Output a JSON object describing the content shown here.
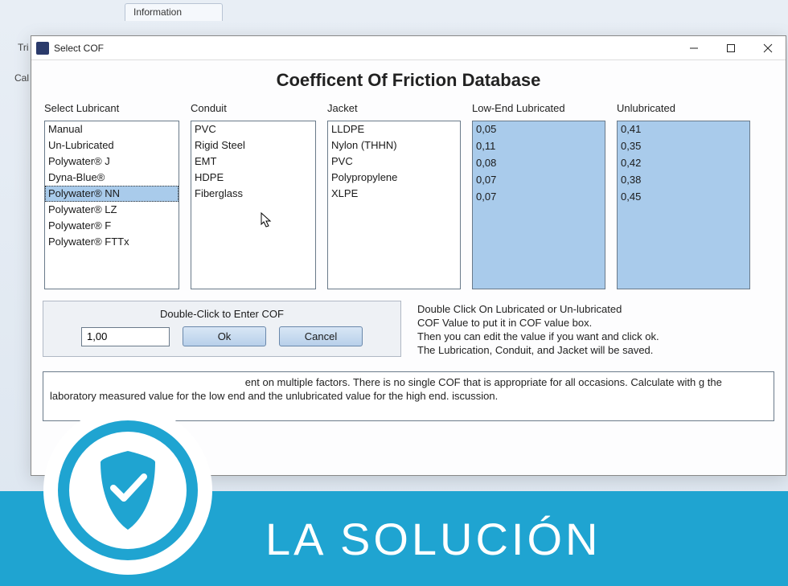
{
  "background": {
    "tab_label": "Information",
    "tri_label": "Tri",
    "cal_label": "Cal"
  },
  "window": {
    "title": "Select COF"
  },
  "main_title": "Coefficent Of Friction Database",
  "headers": {
    "lubricant": "Select Lubricant",
    "conduit": "Conduit",
    "jacket": "Jacket",
    "lowend": "Low-End Lubricated",
    "unlub": "Unlubricated"
  },
  "lubricants": [
    "Manual",
    "Un-Lubricated",
    "Polywater® J",
    "Dyna-Blue®",
    "Polywater® NN",
    "Polywater® LZ",
    "Polywater® F",
    "Polywater® FTTx"
  ],
  "lubricant_selected_index": 4,
  "conduits": [
    "PVC",
    "Rigid Steel",
    "EMT",
    "HDPE",
    "Fiberglass"
  ],
  "jackets": [
    "LLDPE",
    "Nylon (THHN)",
    "PVC",
    "Polypropylene",
    "XLPE"
  ],
  "lowend_values": [
    "0,05",
    "0,11",
    "0,08",
    "0,07",
    "0,07"
  ],
  "unlub_values": [
    "0,41",
    "0,35",
    "0,42",
    "0,38",
    "0,45"
  ],
  "cof_panel": {
    "label": "Double-Click to Enter COF",
    "value": "1,00",
    "ok": "Ok",
    "cancel": "Cancel"
  },
  "instructions": {
    "l1": "Double Click On Lubricated or Un-lubricated",
    "l2": "COF Value to put it in COF value box.",
    "l3": "Then you can edit the value if you want and click ok.",
    "l4": "The Lubrication, Conduit, and Jacket will be saved."
  },
  "info_text": "ent on multiple factors. There is no single COF that is appropriate for all occasions.  Calculate with g the laboratory measured value for the low end and the unlubricated value for the high end. iscussion.",
  "banner": {
    "text": "LA SOLUCIÓN"
  }
}
